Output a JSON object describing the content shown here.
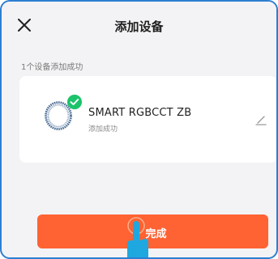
{
  "header": {
    "title": "添加设备",
    "close_icon": "close-icon"
  },
  "subtitle": "1个设备添加成功",
  "device": {
    "name": "SMART RGBCCT ZB",
    "status": "添加成功",
    "icon": "bulb-ring-icon",
    "badge_icon": "check-icon",
    "edit_icon": "pencil-icon"
  },
  "done_button": {
    "label": "完成"
  },
  "colors": {
    "accent": "#ff6233",
    "success": "#1cc36b",
    "frame_border": "#2d7fd2",
    "hand": "#1fa8e0"
  }
}
